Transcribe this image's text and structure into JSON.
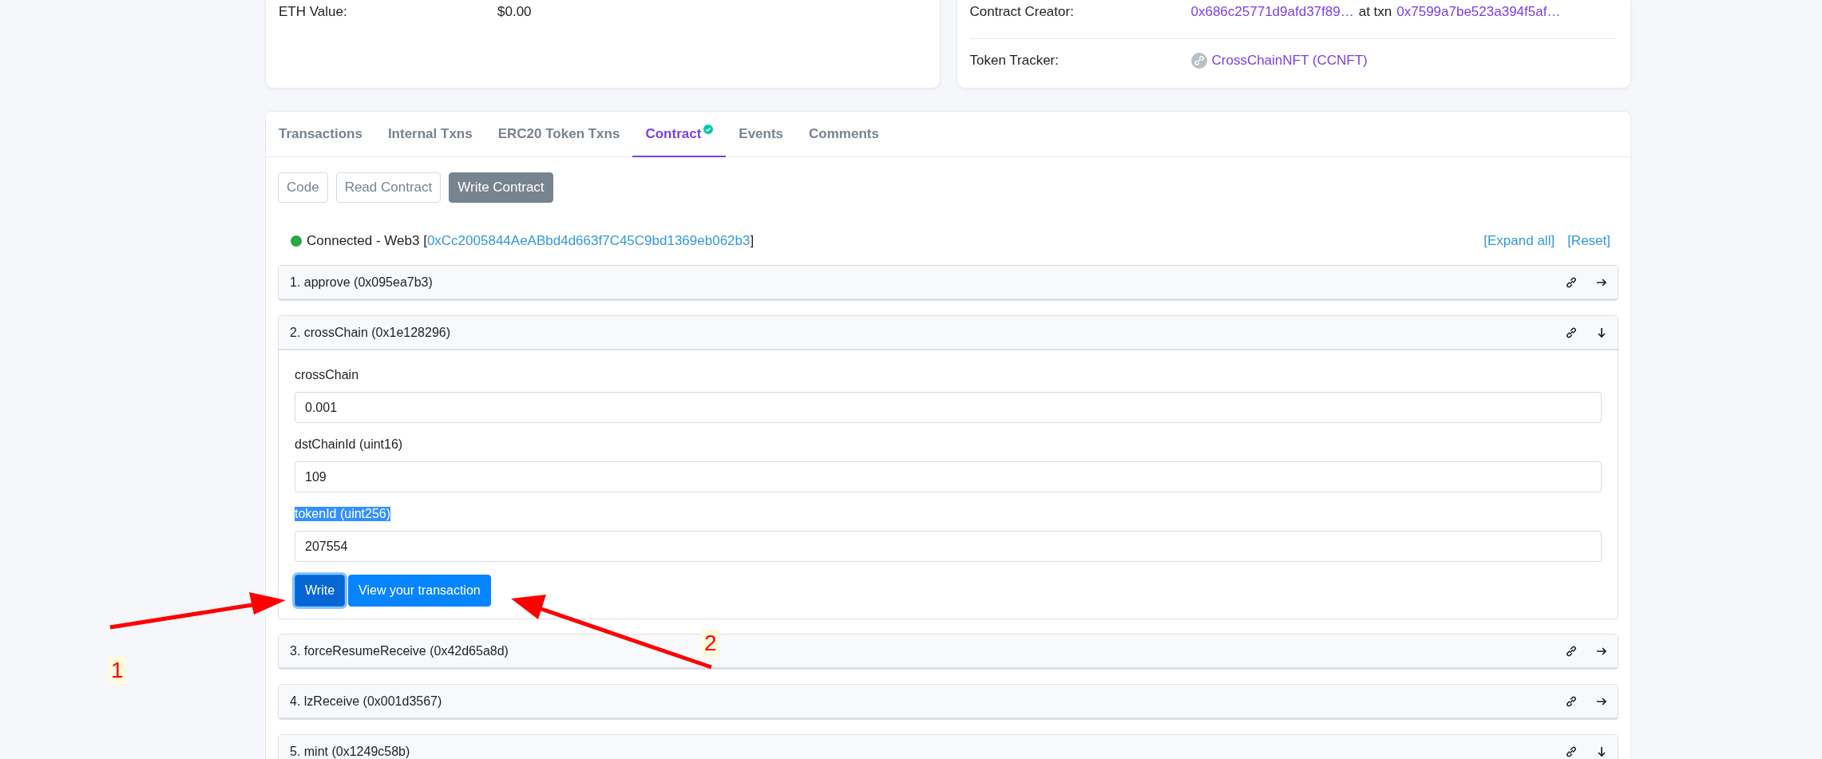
{
  "overview_left": {
    "rows": [
      {
        "label": "ETH Value:",
        "value": "$0.00"
      }
    ]
  },
  "overview_right": {
    "creator": {
      "label": "Contract Creator:",
      "address": "0x686c25771d9afd37f89…",
      "at_text": "at txn",
      "txn": "0x7599a7be523a394f5af…"
    },
    "token_tracker": {
      "label": "Token Tracker:",
      "value": "CrossChainNFT (CCNFT)"
    }
  },
  "tabs": [
    {
      "label": "Transactions",
      "selected": false,
      "verified": false
    },
    {
      "label": "Internal Txns",
      "selected": false,
      "verified": false
    },
    {
      "label": "ERC20 Token Txns",
      "selected": false,
      "verified": false
    },
    {
      "label": "Contract",
      "selected": true,
      "verified": true
    },
    {
      "label": "Events",
      "selected": false,
      "verified": false
    },
    {
      "label": "Comments",
      "selected": false,
      "verified": false
    }
  ],
  "sub_tabs": [
    {
      "label": "Code",
      "selected": false
    },
    {
      "label": "Read Contract",
      "selected": false
    },
    {
      "label": "Write Contract",
      "selected": true
    }
  ],
  "connection": {
    "connected": true,
    "status": "Connected - Web3",
    "open_bracket": "[",
    "close_bracket": "]",
    "address": "0xCc2005844AeABbd4d663f7C45C9bd1369eb062b3",
    "expand_all": "[Expand all]",
    "reset": "[Reset]"
  },
  "methods": [
    {
      "title": "1. approve (0x095ea7b3)",
      "expanded": false
    },
    {
      "title": "2. crossChain (0x1e128296)",
      "expanded": true,
      "fields": [
        {
          "label": "crossChain",
          "value": "0.001",
          "highlighted": false
        },
        {
          "label": "dstChainId (uint16)",
          "value": "109",
          "highlighted": false
        },
        {
          "label": "tokenId (uint256)",
          "value": "207554",
          "highlighted": true
        }
      ],
      "buttons": [
        {
          "label": "Write",
          "focused": true
        },
        {
          "label": "View your transaction",
          "focused": false
        }
      ]
    },
    {
      "title": "3. forceResumeReceive (0x42d65a8d)",
      "expanded": false
    },
    {
      "title": "4. lzReceive (0x001d3567)",
      "expanded": false
    },
    {
      "title": "5. mint (0x1249c58b)",
      "expanded": true
    }
  ],
  "annotations": [
    {
      "label": "1"
    },
    {
      "label": "2"
    }
  ]
}
